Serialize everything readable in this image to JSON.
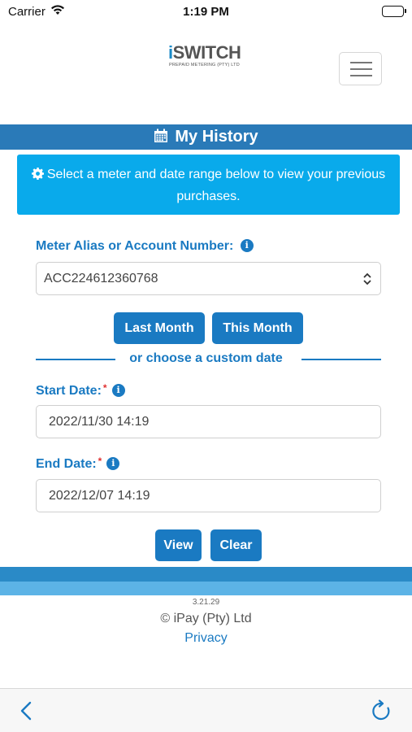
{
  "status_bar": {
    "carrier": "Carrier",
    "time": "1:19 PM"
  },
  "brand": {
    "name_accent": "i",
    "name_rest": "SWITCH",
    "tagline": "PREPAID METERING (PTY) LTD",
    "primary_color": "#1a7ac2",
    "accent_color": "#09aaeb"
  },
  "header": {
    "title": "My History",
    "icon": "calendar-icon"
  },
  "alert": {
    "icon": "gear-icon",
    "message": "Select a meter and date range below to view your previous purchases."
  },
  "meter": {
    "label": "Meter Alias or Account Number:",
    "selected": "ACC224612360768"
  },
  "quick_range": {
    "last_month": "Last Month",
    "this_month": "This Month"
  },
  "divider": {
    "text": "or choose a custom date"
  },
  "start_date": {
    "label": "Start Date:",
    "required_mark": "*",
    "value": "2022/11/30 14:19"
  },
  "end_date": {
    "label": "End Date:",
    "required_mark": "*",
    "value": "2022/12/07 14:19"
  },
  "actions": {
    "view": "View",
    "clear": "Clear"
  },
  "footer": {
    "version": "3.21.29",
    "copyright": "© iPay (Pty) Ltd",
    "privacy": "Privacy"
  },
  "toolbar": {
    "back_icon": "chevron-left-icon",
    "reload_icon": "reload-icon"
  }
}
